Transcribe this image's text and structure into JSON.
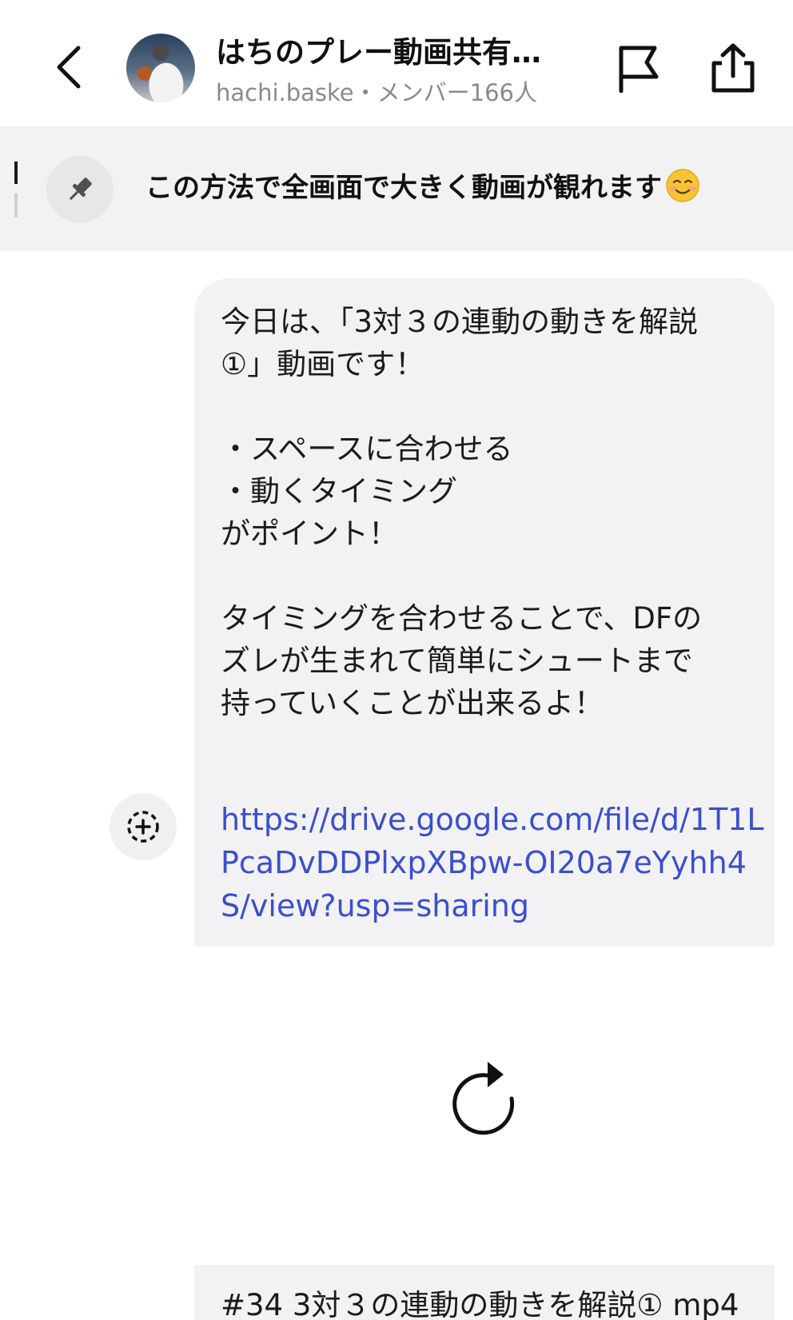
{
  "header": {
    "title": "はちのプレー動画共有…",
    "subtitle": "hachi.baske・メンバー166人",
    "icons": {
      "back": "chevron-left-icon",
      "flag": "flag-icon",
      "share": "share-icon"
    }
  },
  "pinned": {
    "text": "この方法で全画面で大きく動画が観れます",
    "emoji": "smiling-face-icon",
    "icon": "pin-icon"
  },
  "message": {
    "text": "今日は、「3対３の連動の動きを解説\n①」動画です！\n\n・スペースに合わせる\n・動くタイミング\nがポイント！\n\nタイミングを合わせることで、DFの\nズレが生まれて簡単にシュートまで\n持っていくことが出来るよ！",
    "link": "https://drive.google.com/file/d/1T1LPcaDvDDPlxpXBpw-OI20a7eYyhh4S/view?usp=sharing",
    "link_color": "#3b4ecf"
  },
  "reaction_button": {
    "icon": "add-reaction-icon"
  },
  "loading": {
    "icon": "reload-icon"
  },
  "next_message": {
    "text": "#34 3対３の連動の動きを解説① mp4"
  }
}
